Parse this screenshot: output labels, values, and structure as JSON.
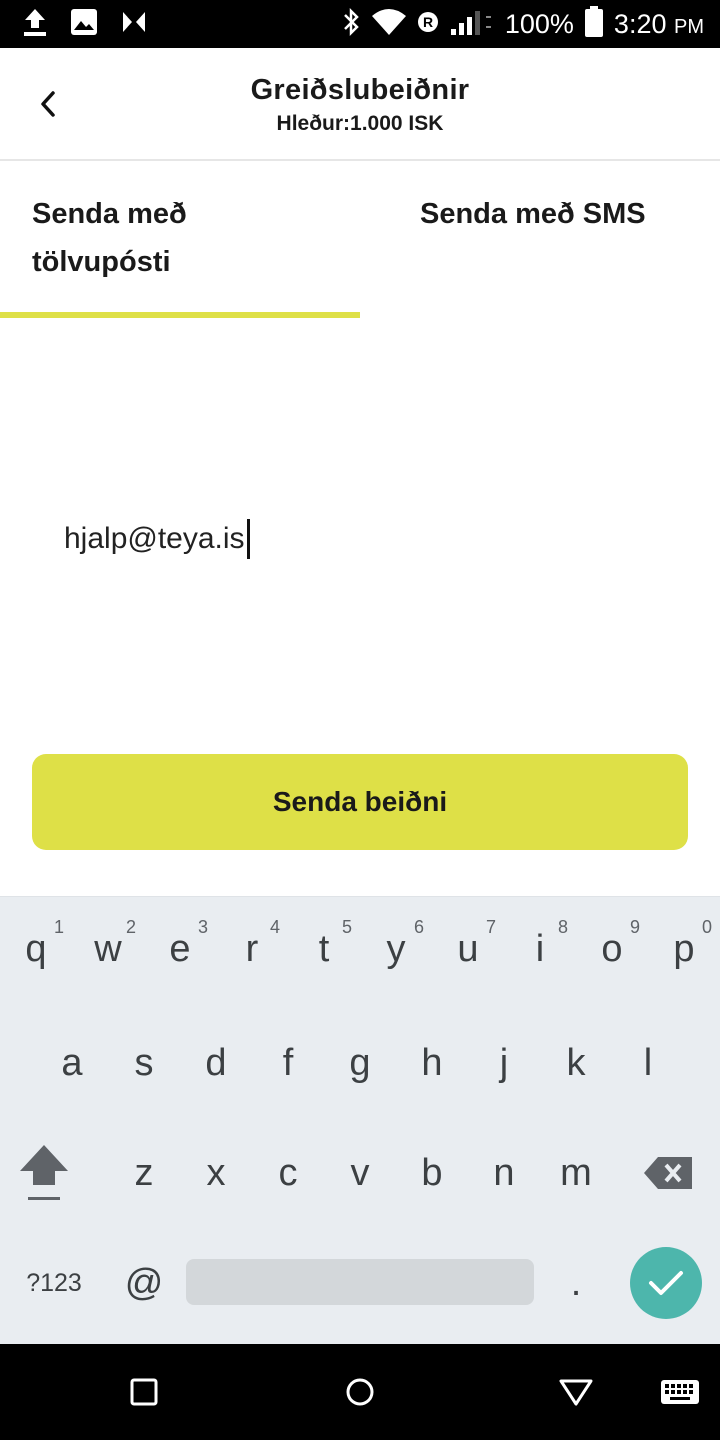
{
  "status_bar": {
    "battery": "100%",
    "time": "3:20",
    "ampm": "PM",
    "icons_left": [
      "upload-icon",
      "image-icon",
      "app-icon"
    ],
    "icons_right": [
      "bluetooth-icon",
      "wifi-icon",
      "roaming-icon",
      "signal-icon",
      "battery-icon"
    ]
  },
  "header": {
    "title": "Greiðslubeiðnir",
    "subtitle": "Hleður:1.000 ISK"
  },
  "tabs": [
    {
      "label": "Senda með tölvupósti",
      "active": true
    },
    {
      "label": "Senda með SMS",
      "active": false
    }
  ],
  "email_field": {
    "value": "hjalp@teya.is"
  },
  "send_button": {
    "label": "Senda beiðni"
  },
  "keyboard": {
    "row1": [
      {
        "key": "q",
        "hint": "1"
      },
      {
        "key": "w",
        "hint": "2"
      },
      {
        "key": "e",
        "hint": "3"
      },
      {
        "key": "r",
        "hint": "4"
      },
      {
        "key": "t",
        "hint": "5"
      },
      {
        "key": "y",
        "hint": "6"
      },
      {
        "key": "u",
        "hint": "7"
      },
      {
        "key": "i",
        "hint": "8"
      },
      {
        "key": "o",
        "hint": "9"
      },
      {
        "key": "p",
        "hint": "0"
      }
    ],
    "row2": [
      "a",
      "s",
      "d",
      "f",
      "g",
      "h",
      "j",
      "k",
      "l"
    ],
    "row3": [
      "z",
      "x",
      "c",
      "v",
      "b",
      "n",
      "m"
    ],
    "symbols_label": "?123",
    "at_label": "@",
    "period_label": "."
  },
  "colors": {
    "accent": "#dee047",
    "enter": "#4db6ac",
    "keyboard_bg": "#e9edf1"
  }
}
